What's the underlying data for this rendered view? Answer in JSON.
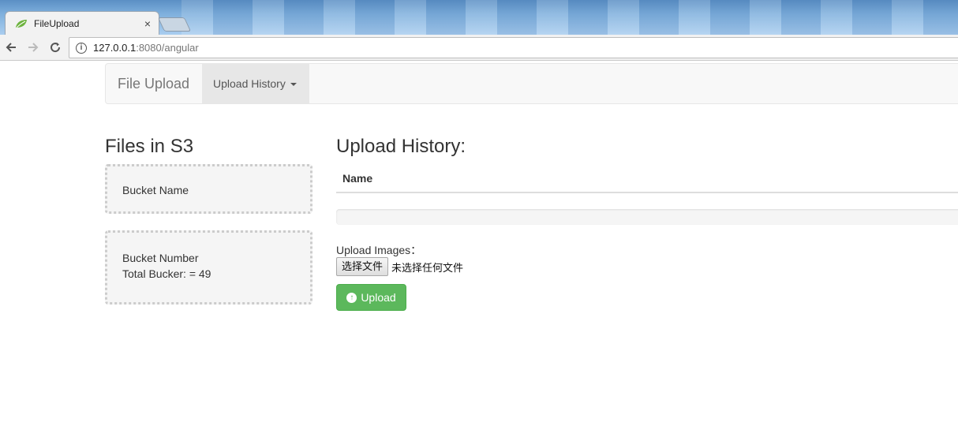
{
  "browser": {
    "tab_title": "FileUpload",
    "tab_close": "×",
    "url_host": "127.0.0.1",
    "url_path": ":8080/angular"
  },
  "navbar": {
    "brand": "File Upload",
    "dropdown_label": "Upload History"
  },
  "left": {
    "heading": "Files in S3",
    "bucket_name_label": "Bucket Name",
    "bucket_number_label": "Bucket Number",
    "total_bucket_text": "Total Bucker: = 49"
  },
  "right": {
    "heading": "Upload History:",
    "table_header_name": "Name",
    "upload_images_label": "Upload Images：",
    "choose_file_button": "选择文件",
    "file_status": "未选择任何文件",
    "upload_button": "Upload"
  },
  "colors": {
    "upload_button": "#5cb85c",
    "favicon": "#6db33f"
  }
}
